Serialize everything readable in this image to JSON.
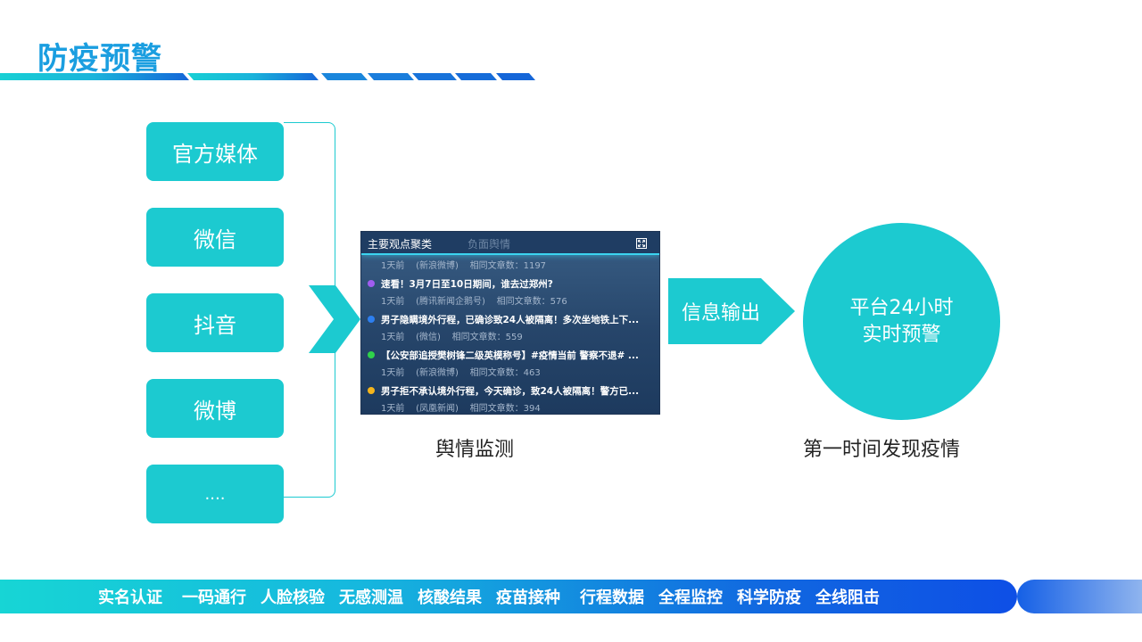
{
  "header": {
    "title": "防疫预警"
  },
  "sources": [
    "官方媒体",
    "微信",
    "抖音",
    "微博",
    "...."
  ],
  "panel": {
    "tab_active": "主要观点聚类",
    "tab_inactive": "负面舆情",
    "items": [
      {
        "title": "",
        "meta": "1天前    (新浪微博)    相同文章数：1197",
        "dot_color": ""
      },
      {
        "title": "速看！3月7日至10日期间，谁去过郑州?",
        "meta": "1天前    (腾讯新闻企鹅号)    相同文章数：576",
        "dot_color": "#a15df0"
      },
      {
        "title": "男子隐瞒境外行程，已确诊致24人被隔离！多次坐地铁上下...",
        "meta": "1天前    (微信)    相同文章数：559",
        "dot_color": "#2d7ff0"
      },
      {
        "title": "【公安部追授樊树锋二级英模称号】#疫情当前 警察不退# ...",
        "meta": "1天前    (新浪微博)    相同文章数：463",
        "dot_color": "#2fd24a"
      },
      {
        "title": "男子拒不承认境外行程，今天确诊，致24人被隔离！警方已...",
        "meta": "1天前    (凤凰新闻)    相同文章数：394",
        "dot_color": "#f5b51c"
      }
    ]
  },
  "caption_monitor": "舆情监测",
  "output_label": "信息输出",
  "circle": {
    "line1": "平台24小时",
    "line2": "实时预警"
  },
  "caption_discover": "第一时间发现疫情",
  "footer": {
    "items": [
      "实名认证",
      "一码通行",
      "人脸核验",
      "无感测温",
      "核酸结果",
      "疫苗接种",
      "行程数据",
      "全程监控",
      "科学防疫",
      "全线阻击"
    ]
  },
  "colors": {
    "teal": "#1ccad0",
    "title_blue": "#1a9ee0"
  }
}
